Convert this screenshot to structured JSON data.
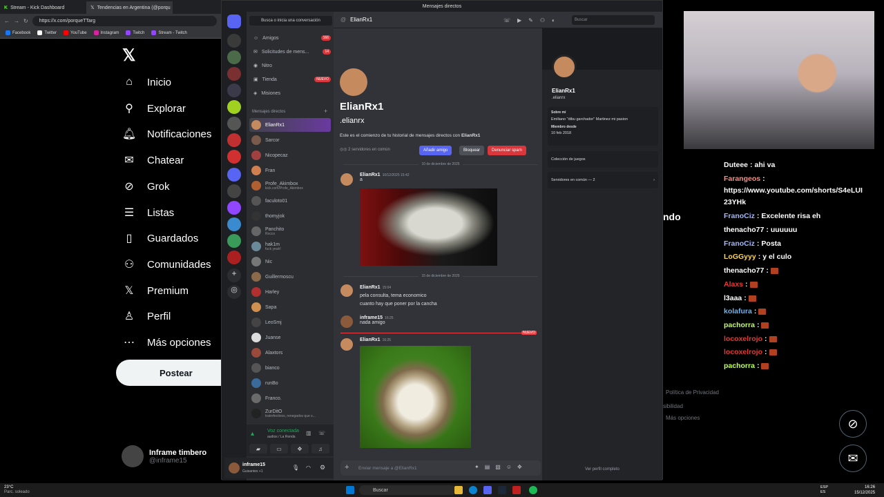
{
  "browser": {
    "tabs": [
      {
        "label": "Stream - Kick Dashboard"
      },
      {
        "label": "Tendencias en Argentina (@porqu"
      }
    ],
    "url": "https://x.com/porqueTTarg",
    "bookmarks": [
      "Facebook",
      "Twitter",
      "YouTube",
      "Instagram",
      "Twitch",
      "Stream - Twitch"
    ]
  },
  "x": {
    "nav": [
      "Inicio",
      "Explorar",
      "Notificaciones",
      "Chatear",
      "Grok",
      "Listas",
      "Guardados",
      "Comunidades",
      "Premium",
      "Perfil",
      "Más opciones"
    ],
    "post_label": "Postear",
    "user_name": "Inframe timbero",
    "user_handle": "@inframe15"
  },
  "discord": {
    "title": "Mensajes directos",
    "search": "Busca o inicia una conversación",
    "shortcuts": [
      {
        "label": "Amigos",
        "badge": "166"
      },
      {
        "label": "Solicitudes de mens...",
        "badge": "14"
      },
      {
        "label": "Nitro",
        "badge": ""
      },
      {
        "label": "Tienda",
        "badge": "NUEVO"
      },
      {
        "label": "Misiones",
        "badge": ""
      }
    ],
    "dm_header": "Mensajes directos",
    "dms": [
      {
        "name": "ElianRx1",
        "sub": "",
        "color": "#c58b5e"
      },
      {
        "name": "Sarcor",
        "sub": "",
        "color": "#7a5a4a"
      },
      {
        "name": "Nicopecaz",
        "sub": "",
        "color": "#a04040"
      },
      {
        "name": "Fran",
        "sub": "",
        "color": "#d08050"
      },
      {
        "name": "Profe_Akimbox",
        "sub": "kick.com/Profe_Akimbox",
        "color": "#b06030"
      },
      {
        "name": "faculoto01",
        "sub": "",
        "color": "#555"
      },
      {
        "name": "thomyjok",
        "sub": "",
        "color": "#333"
      },
      {
        "name": "Panchito",
        "sub": "Rocco",
        "color": "#666"
      },
      {
        "name": "hak1m",
        "sub": "fuck yeah!",
        "color": "#6a8a9a"
      },
      {
        "name": "Nic",
        "sub": "",
        "color": "#777"
      },
      {
        "name": "Guillermoscu",
        "sub": "",
        "color": "#8a6a4a"
      },
      {
        "name": "Harley",
        "sub": "",
        "color": "#b03030"
      },
      {
        "name": "Sapa",
        "sub": "",
        "color": "#d09050"
      },
      {
        "name": "LeoSmj",
        "sub": "",
        "color": "#444"
      },
      {
        "name": "Juanse",
        "sub": "",
        "color": "#ddd"
      },
      {
        "name": "Alaxtors",
        "sub": "",
        "color": "#9a4a3a"
      },
      {
        "name": "bianco",
        "sub": "",
        "color": "#555"
      },
      {
        "name": "runBo",
        "sub": "",
        "color": "#3a6a9a"
      },
      {
        "name": "Franco.",
        "sub": "",
        "color": "#6a6a6a"
      },
      {
        "name": "ZurDitO",
        "sub": "tratrefectivos, renegados que s...",
        "color": "#222"
      }
    ],
    "voice": {
      "status": "Voz conectada",
      "channel": "audios / La Ronda"
    },
    "user": {
      "name": "inframe15",
      "status": "Guisantes +1"
    },
    "chat": {
      "header": "ElianRx1",
      "header_search": "Buscar",
      "big_name": "ElianRx1",
      "big_handle": ".elianrx",
      "intro_prefix": "Este es el comienzo de tu historial de mensajes directos con ",
      "intro_name": "ElianRx1",
      "mutual_servers": "2 servidores en común",
      "btn_add": "Añadir amigo",
      "btn_block": "Bloquear",
      "btn_spam": "Denunciar spam",
      "date1": "10 de diciembre de 2025",
      "date2": "15 de diciembre de 2025",
      "new_label": "NUEVO",
      "messages": [
        {
          "author": "ElianRx1",
          "time": "10/12/2025 15:42",
          "lines": [
            "a"
          ]
        },
        {
          "author": "ElianRx1",
          "time": "15:04",
          "lines": [
            "pela consulta, tema economico",
            "cuanto hay que poner por la cancha"
          ]
        },
        {
          "author": "inframe15",
          "time": "16:25",
          "lines": [
            "nada amigo"
          ]
        },
        {
          "author": "ElianRx1",
          "time": "16:25",
          "lines": []
        }
      ],
      "input_placeholder": "Enviar mensaje a @ElianRx1"
    },
    "profile": {
      "name": "ElianRx1",
      "handle": ".elianrx",
      "about_label": "Sobre mí",
      "about": "Emiliano \"dibu garchador\" Martinez mi pasion",
      "member_label": "Miembro desde",
      "member_since": "10 feb 2018",
      "games": "Colección de juegos",
      "servers": "Servidores en común — 2",
      "full": "Ver perfil completo"
    }
  },
  "stream_chat": [
    {
      "user": "Duteee",
      "msg": "ahi va",
      "color": "#ffffff"
    },
    {
      "user": "Farangeos",
      "msg": "",
      "color": "#ff8a80"
    },
    {
      "user": "",
      "msg": "https://www.youtube.com/shorts/S4eLUI",
      "color": "#ffffff"
    },
    {
      "user": "",
      "msg": "23YHk",
      "color": "#ffffff"
    },
    {
      "user": "FranoCiz",
      "msg": "Excelente risa eh",
      "color": "#a0b8ff"
    },
    {
      "user": "thenacho77",
      "msg": "uuuuuu",
      "color": "#ffffff"
    },
    {
      "user": "FranoCiz",
      "msg": "Posta",
      "color": "#a0b8ff"
    },
    {
      "user": "LoGGyyy",
      "msg": "y el culo",
      "color": "#ffd54f"
    },
    {
      "user": "thenacho77",
      "msg": "",
      "color": "#ffffff"
    },
    {
      "user": "Alaxs",
      "msg": "",
      "color": "#e53935"
    },
    {
      "user": "l3aaa",
      "msg": "",
      "color": "#ffffff"
    },
    {
      "user": "kolafura",
      "msg": "",
      "color": "#64b5f6"
    },
    {
      "user": "pachorra",
      "msg": "",
      "color": "#c0ff60"
    },
    {
      "user": "locoxelrojo",
      "msg": "",
      "color": "#e53935"
    },
    {
      "user": "locoxelrojo",
      "msg": "",
      "color": "#e53935"
    },
    {
      "user": "pachorra",
      "msg": "",
      "color": "#c0ff60"
    }
  ],
  "right_fragments": {
    "ndo": "ndo",
    "privacy": "Política de Privacidad",
    "access": "sibilidad",
    "more": "Más opciones"
  },
  "taskbar": {
    "weather_temp": "23°C",
    "weather_desc": "Parc. soleado",
    "search": "Buscar",
    "lang": "ESP ES",
    "time": "16:26",
    "date": "15/12/2025"
  }
}
